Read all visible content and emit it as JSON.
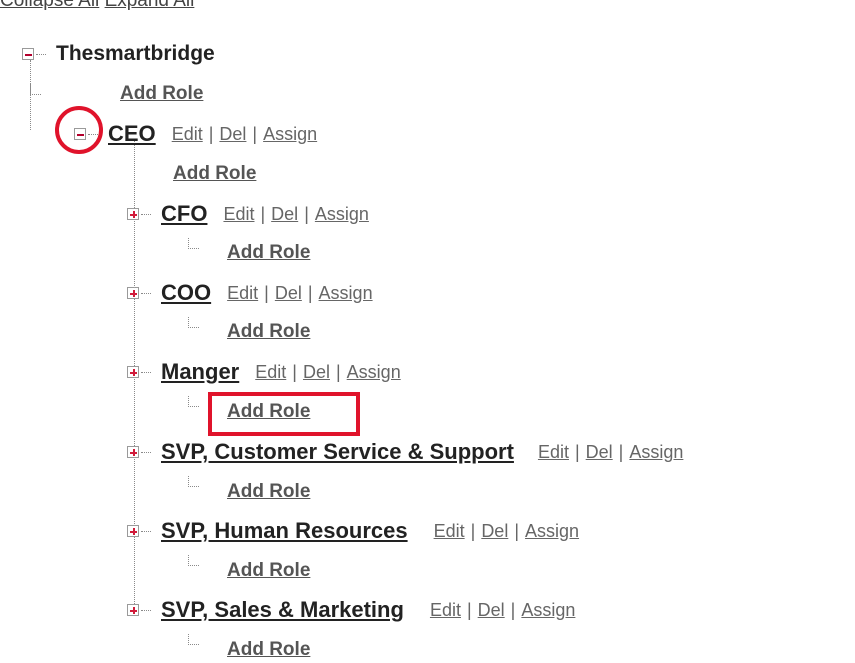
{
  "top_links": {
    "collapse_all": "Collapse All",
    "expand_all": "Expand All"
  },
  "tree": {
    "root": {
      "label": "Thesmartbridge",
      "add_role": "Add Role"
    },
    "ceo": {
      "label": "CEO",
      "edit": "Edit",
      "del": "Del",
      "assign": "Assign",
      "add_role": "Add Role"
    },
    "children": [
      {
        "label": "CFO",
        "edit": "Edit",
        "del": "Del",
        "assign": "Assign",
        "add_role": "Add Role"
      },
      {
        "label": "COO",
        "edit": "Edit",
        "del": "Del",
        "assign": "Assign",
        "add_role": "Add Role"
      },
      {
        "label": "Manger",
        "edit": "Edit",
        "del": "Del",
        "assign": "Assign",
        "add_role": "Add Role"
      },
      {
        "label": "SVP, Customer Service & Support",
        "edit": "Edit",
        "del": "Del",
        "assign": "Assign",
        "add_role": "Add Role"
      },
      {
        "label": "SVP, Human Resources",
        "edit": "Edit",
        "del": "Del",
        "assign": "Assign",
        "add_role": "Add Role"
      },
      {
        "label": "SVP, Sales & Marketing",
        "edit": "Edit",
        "del": "Del",
        "assign": "Assign",
        "add_role": "Add Role"
      }
    ],
    "separator": "|"
  },
  "annotations": {
    "highlight_color": "#e0132b"
  }
}
